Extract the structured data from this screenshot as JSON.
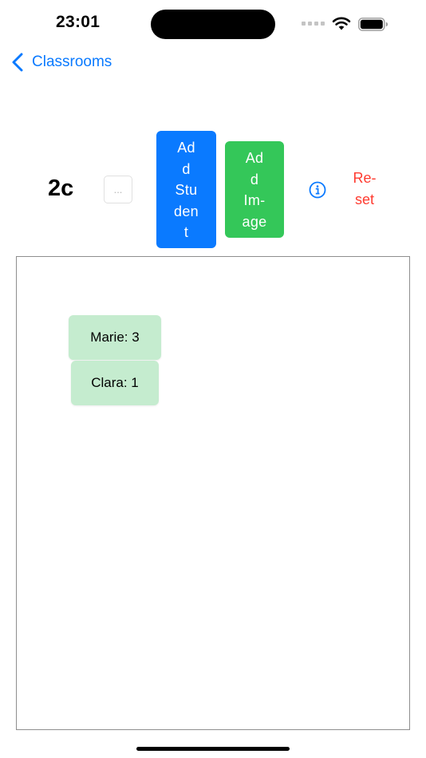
{
  "status_bar": {
    "time": "23:01",
    "icons": [
      "signal-icon",
      "wifi-icon",
      "battery-icon"
    ]
  },
  "nav": {
    "back_label": "Classrooms",
    "back_icon": "chevron-left-icon"
  },
  "toolbar": {
    "class_name": "2c",
    "more_label": "...",
    "add_student_lines": [
      "Ad",
      "d",
      "Stu",
      "den",
      "t"
    ],
    "add_image_lines": [
      "Ad",
      "d",
      "Im-",
      "age"
    ],
    "info_icon": "info-circle-icon",
    "reset_lines": [
      "Re-",
      "set"
    ]
  },
  "canvas": {
    "students": [
      {
        "label": "Marie: 3"
      },
      {
        "label": "Clara: 1"
      }
    ]
  },
  "colors": {
    "accent_blue": "#0a7aff",
    "accent_green": "#34c759",
    "destructive_red": "#ff3b30",
    "card_green": "#c5eccf"
  }
}
